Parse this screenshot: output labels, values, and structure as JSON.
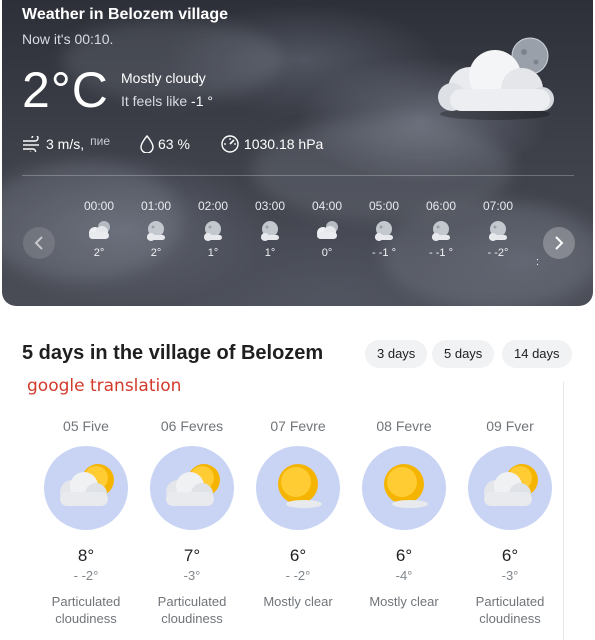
{
  "current": {
    "title": "Weather in Belozem village",
    "time_text": "Now it's 00:10.",
    "temperature": "2°C",
    "condition": "Mostly cloudy",
    "feels_like_prefix": "It feels like",
    "feels_like_value": "-1 °",
    "icon": "cloud-moon-icon",
    "wind": "3 m/s,",
    "wind_direction": "пие",
    "humidity": "63 %",
    "pressure": "1030.18 hPa"
  },
  "hourly": [
    {
      "time": "00:00",
      "temp": "2°",
      "icon": "cloud-moon-icon"
    },
    {
      "time": "01:00",
      "temp": "2°",
      "icon": "moon-small-cloud-icon"
    },
    {
      "time": "02:00",
      "temp": "1°",
      "icon": "moon-small-cloud-icon"
    },
    {
      "time": "03:00",
      "temp": "1°",
      "icon": "moon-small-cloud-icon"
    },
    {
      "time": "04:00",
      "temp": "0°",
      "icon": "cloud-moon-icon"
    },
    {
      "time": "05:00",
      "temp": "- -1 °",
      "icon": "moon-small-cloud-icon"
    },
    {
      "time": "06:00",
      "temp": "- -1 °",
      "icon": "moon-small-cloud-icon"
    },
    {
      "time": "07:00",
      "temp": "- -2°",
      "icon": "moon-small-cloud-icon"
    }
  ],
  "hourly_cut_label": ":",
  "forecast": {
    "title": "5 days in the village of Belozem",
    "tabs": [
      "3 days",
      "5 days",
      "14 days"
    ],
    "translation_note": "google translation",
    "days": [
      {
        "date": "05 Five",
        "max": "8°",
        "min": "- -2°",
        "desc_line1": "Particulated",
        "desc_line2": "cloudiness",
        "icon": "sun-cloud-icon"
      },
      {
        "date": "06 Fevres",
        "max": "7°",
        "min": "-3°",
        "desc_line1": "Particulated",
        "desc_line2": "cloudiness",
        "icon": "sun-cloud-icon"
      },
      {
        "date": "07 Fevre",
        "max": "6°",
        "min": "- -2°",
        "desc_line1": "Mostly clear",
        "desc_line2": "",
        "icon": "sun-small-cloud-icon"
      },
      {
        "date": "08 Fevre",
        "max": "6°",
        "min": "-4°",
        "desc_line1": "Mostly clear",
        "desc_line2": "",
        "icon": "sun-small-cloud-icon"
      },
      {
        "date": "09 Fver",
        "max": "6°",
        "min": "-3°",
        "desc_line1": "Particulated",
        "desc_line2": "cloudiness",
        "icon": "sun-cloud-icon"
      }
    ]
  },
  "colors": {
    "card_dark": "#3c3f48",
    "day_circle": "#c9d4f5",
    "sun": "#f5b400",
    "translation_red": "#d23a2a"
  }
}
